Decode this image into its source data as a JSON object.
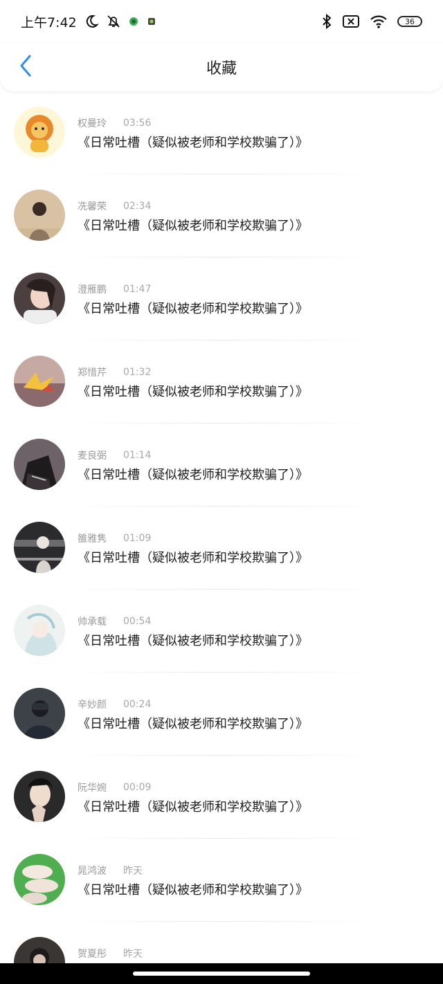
{
  "status_bar": {
    "time": "上午7:42",
    "left_icons": [
      "moon-icon",
      "bell-off-icon",
      "app-icon-green",
      "app-icon-small"
    ],
    "right_icons": [
      "bluetooth-icon",
      "sim-x-icon",
      "wifi-icon"
    ],
    "battery": "36"
  },
  "header": {
    "title": "收藏",
    "back_icon": "chevron-left-icon",
    "accent": "#2f8fe8"
  },
  "items": [
    {
      "name": "权曼玲",
      "time": "03:56",
      "title": "《日常吐槽（疑似被老师和学校欺骗了）》"
    },
    {
      "name": "冼馨荣",
      "time": "02:34",
      "title": "《日常吐槽（疑似被老师和学校欺骗了）》"
    },
    {
      "name": "澄雁鹏",
      "time": "01:47",
      "title": "《日常吐槽（疑似被老师和学校欺骗了）》"
    },
    {
      "name": "郑惜芹",
      "time": "01:32",
      "title": "《日常吐槽（疑似被老师和学校欺骗了）》"
    },
    {
      "name": "麦良弼",
      "time": "01:14",
      "title": "《日常吐槽（疑似被老师和学校欺骗了）》"
    },
    {
      "name": "雒雅隽",
      "time": "01:09",
      "title": "《日常吐槽（疑似被老师和学校欺骗了）》"
    },
    {
      "name": "帅承载",
      "time": "00:54",
      "title": "《日常吐槽（疑似被老师和学校欺骗了）》"
    },
    {
      "name": "辛妙颜",
      "time": "00:24",
      "title": "《日常吐槽（疑似被老师和学校欺骗了）》"
    },
    {
      "name": "阮华婉",
      "time": "00:09",
      "title": "《日常吐槽（疑似被老师和学校欺骗了）》"
    },
    {
      "name": "晁鸿波",
      "time": "昨天",
      "title": "《日常吐槽（疑似被老师和学校欺骗了）》"
    },
    {
      "name": "贺夏彤",
      "time": "昨天",
      "title": ""
    }
  ]
}
